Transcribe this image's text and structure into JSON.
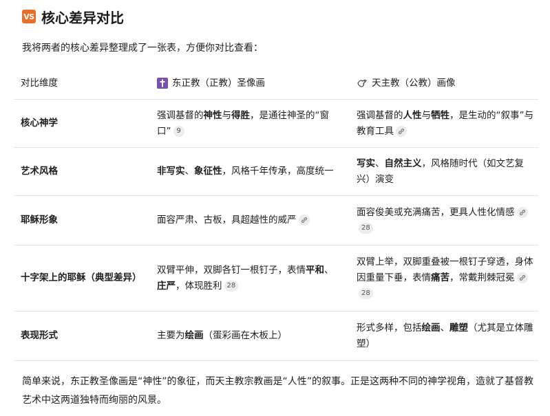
{
  "heading": {
    "icon_text": "VS",
    "title": "核心差异对比"
  },
  "intro": "我将两者的核心差异整理成了一张表，方便你对比查看：",
  "table": {
    "headers": {
      "dimension": "对比维度",
      "orthodox": "东正教（正教）圣像画",
      "catholic": "天主教（公教）画像",
      "orthodox_icon": "cross-icon",
      "catholic_icon": "dove-icon"
    },
    "rows": [
      {
        "dimension": "核心神学",
        "orthodox": {
          "a": "强调基督的",
          "b1": "神性",
          "c": "与",
          "b2": "得胜",
          "d": "，是通往神圣的“窗口”",
          "ref": "9"
        },
        "catholic": {
          "a": "强调基督的",
          "b1": "人性",
          "c": "与",
          "b2": "牺牲",
          "d": "，是生动的“叙事”与教育工具"
        }
      },
      {
        "dimension": "艺术风格",
        "orthodox": {
          "b1": "非写实",
          "c": "、",
          "b2": "象征性",
          "d": "，风格千年传承，高度统一"
        },
        "catholic": {
          "b1": "写实",
          "c": "、",
          "b2": "自然主义",
          "d": "，风格随时代（如文艺复兴）演变"
        }
      },
      {
        "dimension": "耶稣形象",
        "orthodox": {
          "text": "面容严肃、古板，具超越性的威严"
        },
        "catholic": {
          "text": "面容俊美或充满痛苦，更具人性化情感",
          "ref": "28"
        }
      },
      {
        "dimension": "十字架上的耶稣（典型差异）",
        "orthodox": {
          "a": "双臂平伸，双脚各钉一根钉子，表情",
          "b1": "平和",
          "c": "、",
          "b2": "庄严",
          "d": "，体现胜利",
          "ref": "28"
        },
        "catholic": {
          "a": "双臂上举，双脚重叠被一根钉子穿透，身体因重量下垂，表情",
          "b1": "痛苦",
          "d": "，常戴荆棘冠冕",
          "ref": "28"
        }
      },
      {
        "dimension": "表现形式",
        "orthodox": {
          "a": "主要为",
          "b1": "绘画",
          "d": "（蛋彩画在木板上）"
        },
        "catholic": {
          "a": "形式多样，包括",
          "b1": "绘画",
          "c": "、",
          "b2": "雕塑",
          "d": "（尤其是立体雕塑）"
        }
      }
    ]
  },
  "outro": "简单来说，东正教圣像画是“神性”的象征，而天主教宗教画是“人性”的叙事。正是这两种不同的神学视角，造就了基督教艺术中这两道独特而绚丽的风景。",
  "colors": {
    "vs_badge": "#e8702a",
    "cross_badge": "#7a4fb5"
  }
}
